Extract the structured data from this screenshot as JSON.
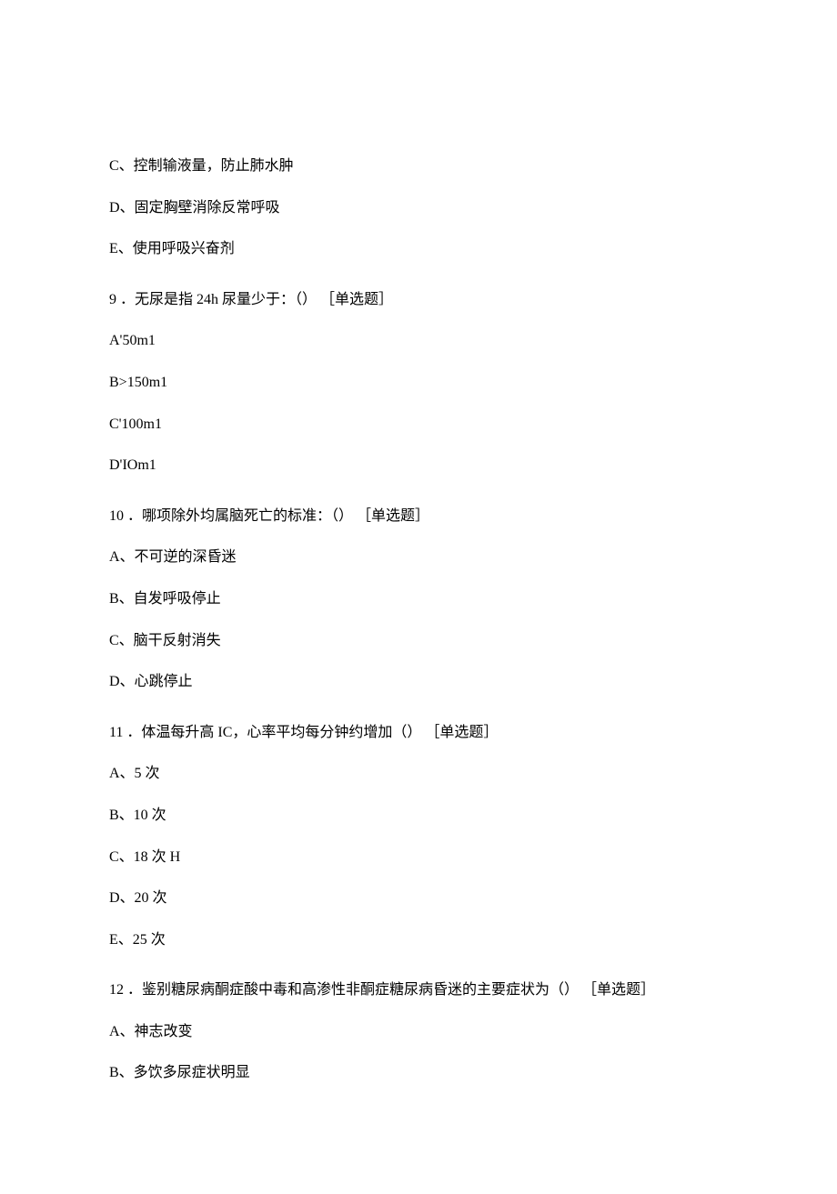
{
  "lines": [
    {
      "text": "C、控制输液量，防止肺水肿",
      "cls": "line"
    },
    {
      "text": "D、固定胸壁消除反常呼吸",
      "cls": "line"
    },
    {
      "text": "E、使用呼吸兴奋剂",
      "cls": "line"
    },
    {
      "text": "9 ．无尿是指 24h 尿量少于：（） ［单选题］",
      "cls": "question"
    },
    {
      "text": "A'50m1",
      "cls": "line"
    },
    {
      "text": "B>150m1",
      "cls": "line"
    },
    {
      "text": "C'100m1",
      "cls": "line"
    },
    {
      "text": "D'IOm1",
      "cls": "line"
    },
    {
      "text": "10 ．哪项除外均属脑死亡的标准：（） ［单选题］",
      "cls": "question"
    },
    {
      "text": "A、不可逆的深昏迷",
      "cls": "line"
    },
    {
      "text": "B、自发呼吸停止",
      "cls": "line"
    },
    {
      "text": "C、脑干反射消失",
      "cls": "line"
    },
    {
      "text": "D、心跳停止",
      "cls": "line"
    },
    {
      "text": "11 ．体温每升高 IC，心率平均每分钟约增加（） ［单选题］",
      "cls": "question"
    },
    {
      "text": "A、5 次",
      "cls": "line"
    },
    {
      "text": "B、10 次",
      "cls": "line"
    },
    {
      "text": "C、18 次 H",
      "cls": "line"
    },
    {
      "text": "D、20 次",
      "cls": "line"
    },
    {
      "text": "E、25 次",
      "cls": "line"
    },
    {
      "text": "12 ．鉴别糖尿病酮症酸中毒和高渗性非酮症糖尿病昏迷的主要症状为（） ［单选题］",
      "cls": "question"
    },
    {
      "text": "A、神志改变",
      "cls": "line"
    },
    {
      "text": "B、多饮多尿症状明显",
      "cls": "line"
    }
  ]
}
